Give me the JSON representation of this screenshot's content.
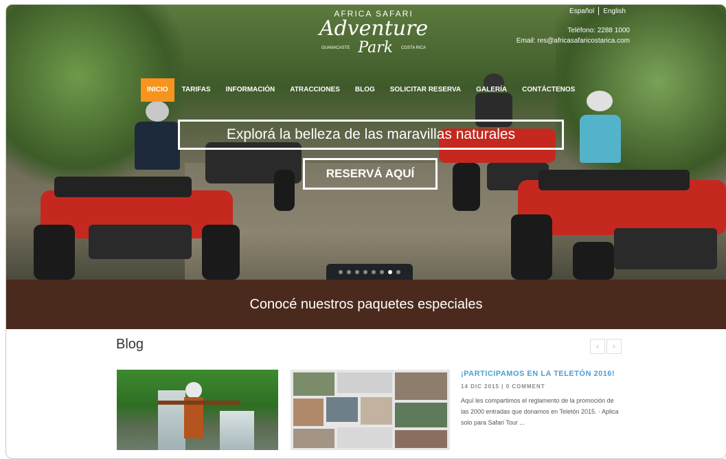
{
  "header": {
    "languages": [
      "Español",
      "English"
    ],
    "phone": "Teléfono: 2288 1000",
    "email": "Email: res@africasafaricostarica.com",
    "logo": {
      "line1": "AFRICA SAFARI",
      "line2": "Adventure",
      "line3_left": "GUANACASTE",
      "line3_mid": "Park",
      "line3_right": "COSTA RICA"
    }
  },
  "nav": {
    "items": [
      "INICIO",
      "TARIFAS",
      "INFORMACIÓN",
      "ATRACCIONES",
      "BLOG",
      "SOLICITAR RESERVA",
      "GALERÍA",
      "CONTÁCTENOS"
    ],
    "active_index": 0
  },
  "hero": {
    "slogan": "Explorá la belleza de las maravillas naturales",
    "cta": "RESERVÁ AQUÍ",
    "slides": 8,
    "active_slide": 6
  },
  "band": {
    "text": "Conocé nuestros paquetes especiales"
  },
  "blog": {
    "title": "Blog",
    "prev": "‹",
    "next": "›",
    "post": {
      "title": "¡PARTICIPAMOS EN LA TELETÓN 2016!",
      "meta": "14 DIC 2015 | 0 COMMENT",
      "excerpt": "Aquí les compartimos el reglamento de la promoción de las 2000 entradas que donamos en Teletón 2015. · Aplica solo para Safari Tour ..."
    }
  },
  "colors": {
    "accent": "#f7941d",
    "band": "#4b2a1e",
    "link": "#4a9fd6"
  }
}
